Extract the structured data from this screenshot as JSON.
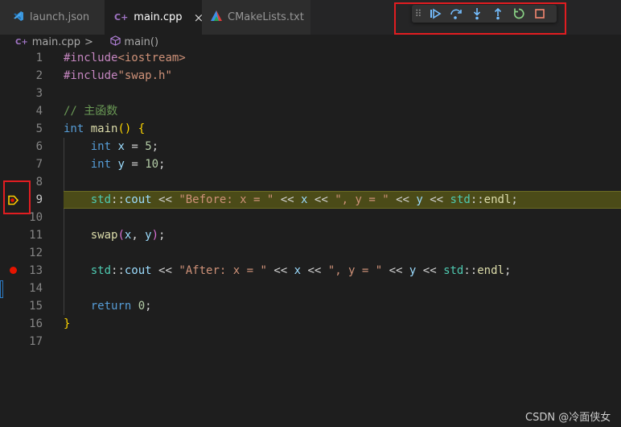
{
  "tabs": [
    {
      "label": "launch.json",
      "icon": "vscode-icon",
      "active": false
    },
    {
      "label": "main.cpp",
      "icon": "cpp-file-icon",
      "active": true
    },
    {
      "label": "CMakeLists.txt",
      "icon": "cmake-icon",
      "active": false
    }
  ],
  "tab_active_close": "×",
  "breadcrumb": {
    "file": "main.cpp",
    "sep": ">",
    "symbol": "main()"
  },
  "debug_toolbar": [
    "drag-handle",
    "continue",
    "step-over",
    "step-into",
    "step-out",
    "restart",
    "stop"
  ],
  "lines": [
    {
      "n": "1",
      "tokens": [
        [
          "pp",
          "#include"
        ],
        [
          "str",
          "<iostream>"
        ]
      ]
    },
    {
      "n": "2",
      "tokens": [
        [
          "pp",
          "#include"
        ],
        [
          "str",
          "\"swap.h\""
        ]
      ]
    },
    {
      "n": "3",
      "tokens": []
    },
    {
      "n": "4",
      "tokens": [
        [
          "cmt",
          "// 主函数"
        ]
      ]
    },
    {
      "n": "5",
      "tokens": [
        [
          "kw",
          "int"
        ],
        [
          "plain",
          " "
        ],
        [
          "fn",
          "main"
        ],
        [
          "br1",
          "()"
        ],
        [
          "plain",
          " "
        ],
        [
          "br1",
          "{"
        ]
      ]
    },
    {
      "n": "6",
      "tokens": [
        [
          "plain",
          "    "
        ],
        [
          "kw",
          "int"
        ],
        [
          "plain",
          " "
        ],
        [
          "var",
          "x"
        ],
        [
          "plain",
          " = "
        ],
        [
          "num",
          "5"
        ],
        [
          "plain",
          ";"
        ]
      ]
    },
    {
      "n": "7",
      "tokens": [
        [
          "plain",
          "    "
        ],
        [
          "kw",
          "int"
        ],
        [
          "plain",
          " "
        ],
        [
          "var",
          "y"
        ],
        [
          "plain",
          " = "
        ],
        [
          "num",
          "10"
        ],
        [
          "plain",
          ";"
        ]
      ]
    },
    {
      "n": "8",
      "tokens": []
    },
    {
      "n": "9",
      "tokens": [
        [
          "plain",
          "    "
        ],
        [
          "ty",
          "std"
        ],
        [
          "plain",
          "::"
        ],
        [
          "var",
          "cout"
        ],
        [
          "plain",
          " << "
        ],
        [
          "str",
          "\"Before: x = \""
        ],
        [
          "plain",
          " << "
        ],
        [
          "var",
          "x"
        ],
        [
          "plain",
          " << "
        ],
        [
          "str",
          "\", y = \""
        ],
        [
          "plain",
          " << "
        ],
        [
          "var",
          "y"
        ],
        [
          "plain",
          " << "
        ],
        [
          "ty",
          "std"
        ],
        [
          "plain",
          "::"
        ],
        [
          "fn",
          "endl"
        ],
        [
          "plain",
          ";"
        ]
      ]
    },
    {
      "n": "10",
      "tokens": []
    },
    {
      "n": "11",
      "tokens": [
        [
          "plain",
          "    "
        ],
        [
          "fn",
          "swap"
        ],
        [
          "br2",
          "("
        ],
        [
          "var",
          "x"
        ],
        [
          "plain",
          ", "
        ],
        [
          "var",
          "y"
        ],
        [
          "br2",
          ")"
        ],
        [
          "plain",
          ";"
        ]
      ]
    },
    {
      "n": "12",
      "tokens": []
    },
    {
      "n": "13",
      "tokens": [
        [
          "plain",
          "    "
        ],
        [
          "ty",
          "std"
        ],
        [
          "plain",
          "::"
        ],
        [
          "var",
          "cout"
        ],
        [
          "plain",
          " << "
        ],
        [
          "str",
          "\"After: x = \""
        ],
        [
          "plain",
          " << "
        ],
        [
          "var",
          "x"
        ],
        [
          "plain",
          " << "
        ],
        [
          "str",
          "\", y = \""
        ],
        [
          "plain",
          " << "
        ],
        [
          "var",
          "y"
        ],
        [
          "plain",
          " << "
        ],
        [
          "ty",
          "std"
        ],
        [
          "plain",
          "::"
        ],
        [
          "fn",
          "endl"
        ],
        [
          "plain",
          ";"
        ]
      ]
    },
    {
      "n": "14",
      "tokens": []
    },
    {
      "n": "15",
      "tokens": [
        [
          "plain",
          "    "
        ],
        [
          "kw",
          "return"
        ],
        [
          "plain",
          " "
        ],
        [
          "num",
          "0"
        ],
        [
          "plain",
          ";"
        ]
      ]
    },
    {
      "n": "16",
      "tokens": [
        [
          "br1",
          "}"
        ]
      ]
    },
    {
      "n": "17",
      "tokens": []
    }
  ],
  "current_line": "9",
  "breakpoint_line": "13",
  "colors": {
    "accent_blue": "#75beff",
    "restart_green": "#89d185",
    "stop_red": "#f48771",
    "breakpoint": "#e51400",
    "current_line": "#ffcc00",
    "highlight_red_box": "#e11d21"
  },
  "watermark": "CSDN @冷面侠女"
}
